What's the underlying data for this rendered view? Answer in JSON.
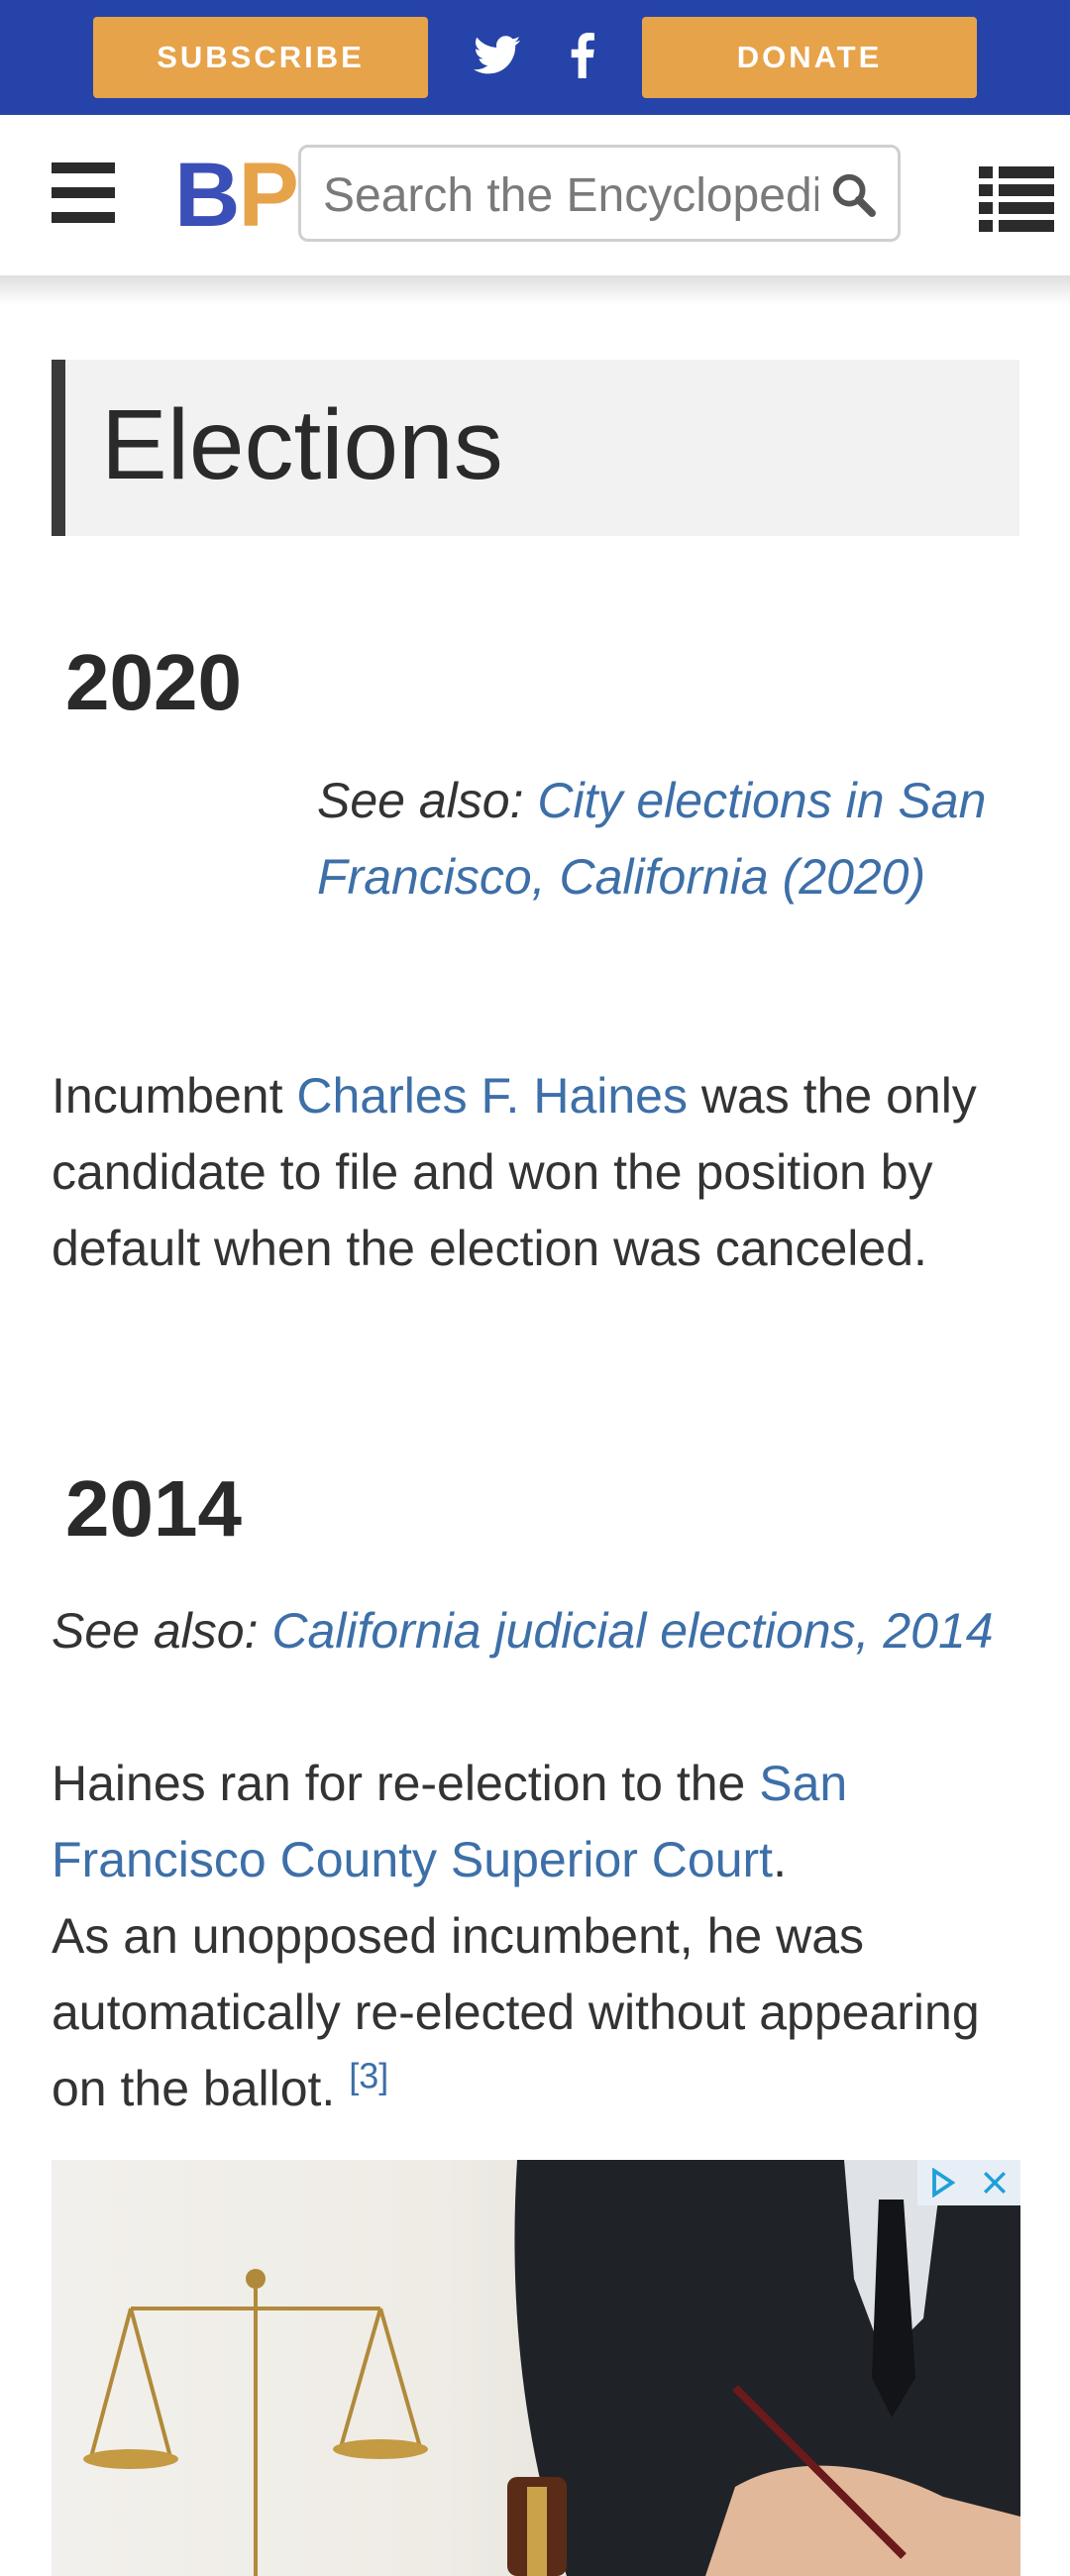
{
  "topbar": {
    "subscribe_label": "SUBSCRIBE",
    "donate_label": "DONATE",
    "twitter_icon": "twitter-icon",
    "facebook_icon": "facebook-icon",
    "accent_color": "#e6a34a",
    "bar_color": "#2543a8"
  },
  "header": {
    "logo_b": "B",
    "logo_p": "P",
    "search_placeholder": "Search the Encyclopedia",
    "menu_icon": "hamburger-menu-icon",
    "search_icon": "search-icon",
    "toc_icon": "list-icon"
  },
  "content": {
    "section_title": "Elections",
    "y2020": {
      "heading": "2020",
      "see_also_prefix": "See also: ",
      "see_also_link": "City elections in San Francisco, California (2020)",
      "para_before": "Incumbent ",
      "para_link": "Charles F. Haines",
      "para_after": " was the only candidate to file and won the position by default when the election was canceled."
    },
    "y2014": {
      "heading": "2014",
      "see_also_prefix": "See also: ",
      "see_also_link": "California judicial elections, 2014",
      "para_before": "Haines ran for re-election to the ",
      "para_link": "San Francisco County Superior Court",
      "para_mid": ".",
      "para_after": "As an unopposed incumbent, he was automatically re-elected without appearing on the ballot. ",
      "ref": "[3]"
    }
  },
  "ad": {
    "info_icon": "ad-choices-icon",
    "close_icon": "close-icon"
  }
}
